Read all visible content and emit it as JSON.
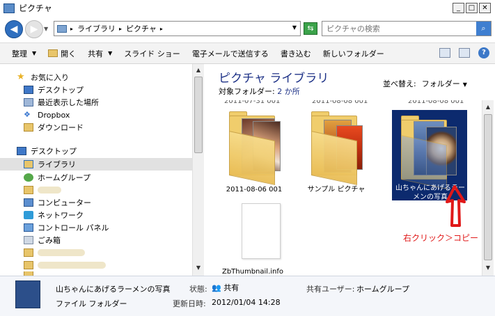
{
  "window": {
    "title": "ピクチャ",
    "minimize": "_",
    "maximize": "□",
    "close": "✕"
  },
  "address": {
    "breadcrumbs": [
      "ライブラリ",
      "ピクチャ"
    ],
    "search_placeholder": "ピクチャの検索"
  },
  "toolbar": {
    "organize": "整理",
    "open": "開く",
    "share": "共有",
    "slideshow": "スライド ショー",
    "email": "電子メールで送信する",
    "burn": "書き込む",
    "new_folder": "新しいフォルダー"
  },
  "nav": {
    "favorites": "お気に入り",
    "desktop_fav": "デスクトップ",
    "recent": "最近表示した場所",
    "dropbox": "Dropbox",
    "downloads": "ダウンロード",
    "desktop": "デスクトップ",
    "libraries": "ライブラリ",
    "homegroup": "ホームグループ",
    "computer": "コンピューター",
    "network": "ネットワーク",
    "control_panel": "コントロール パネル",
    "trash": "ごみ箱"
  },
  "content": {
    "library_title": "ピクチャ ライブラリ",
    "target_label": "対象フォルダー:",
    "target_value": "2 か所",
    "arrange_label": "並べ替え:",
    "arrange_value": "フォルダー",
    "cut_labels": [
      "2011-07-31 001",
      "2011-08-08 001",
      "2011-08-08 001"
    ],
    "items": [
      {
        "name": "2011-08-06 001"
      },
      {
        "name": "サンプル ピクチャ"
      },
      {
        "name": "山ちゃんにあげるラーメンの写真"
      },
      {
        "name": "ZbThumbnail.info"
      }
    ]
  },
  "annotation": {
    "text": "右クリック＞コピー",
    "color": "#e01818"
  },
  "details": {
    "name": "山ちゃんにあげるラーメンの写真",
    "type": "ファイル フォルダー",
    "status_label": "状態:",
    "status_value": "共有",
    "modified_label": "更新日時:",
    "modified_value": "2012/01/04 14:28",
    "shared_with_label": "共有ユーザー:",
    "shared_with_value": "ホームグループ"
  }
}
